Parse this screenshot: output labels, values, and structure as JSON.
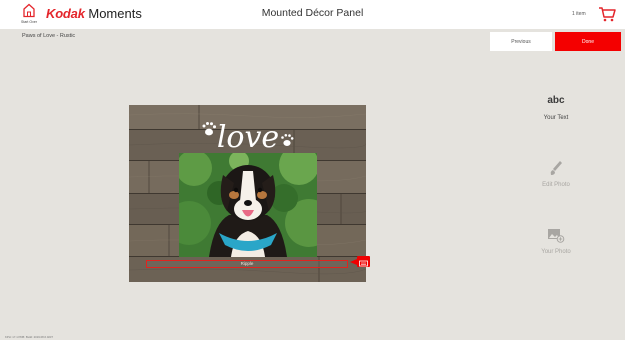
{
  "header": {
    "home_label": "Start Over",
    "brand_kodak": "Kodak",
    "brand_moments": "Moments",
    "title": "Mounted Décor Panel",
    "cart_count": "1 item"
  },
  "subheader": {
    "product_name": "Paws of Love - Rustic",
    "previous_label": "Previous",
    "done_label": "Done"
  },
  "canvas": {
    "title_text": "love",
    "caption_text": "Ripple"
  },
  "tools": [
    {
      "icon_text": "abc",
      "label": "Your Text",
      "enabled": true
    },
    {
      "icon": "brush-icon",
      "label": "Edit Photo",
      "enabled": false
    },
    {
      "icon": "photo-add-icon",
      "label": "Your Photo",
      "enabled": false
    }
  ],
  "footer": {
    "build_info": "KPH: 17.1 PDB: Build: 2019.08.6.0237"
  },
  "colors": {
    "accent": "#f40000",
    "brand_red": "#e4252b",
    "background": "#e5e3de"
  }
}
